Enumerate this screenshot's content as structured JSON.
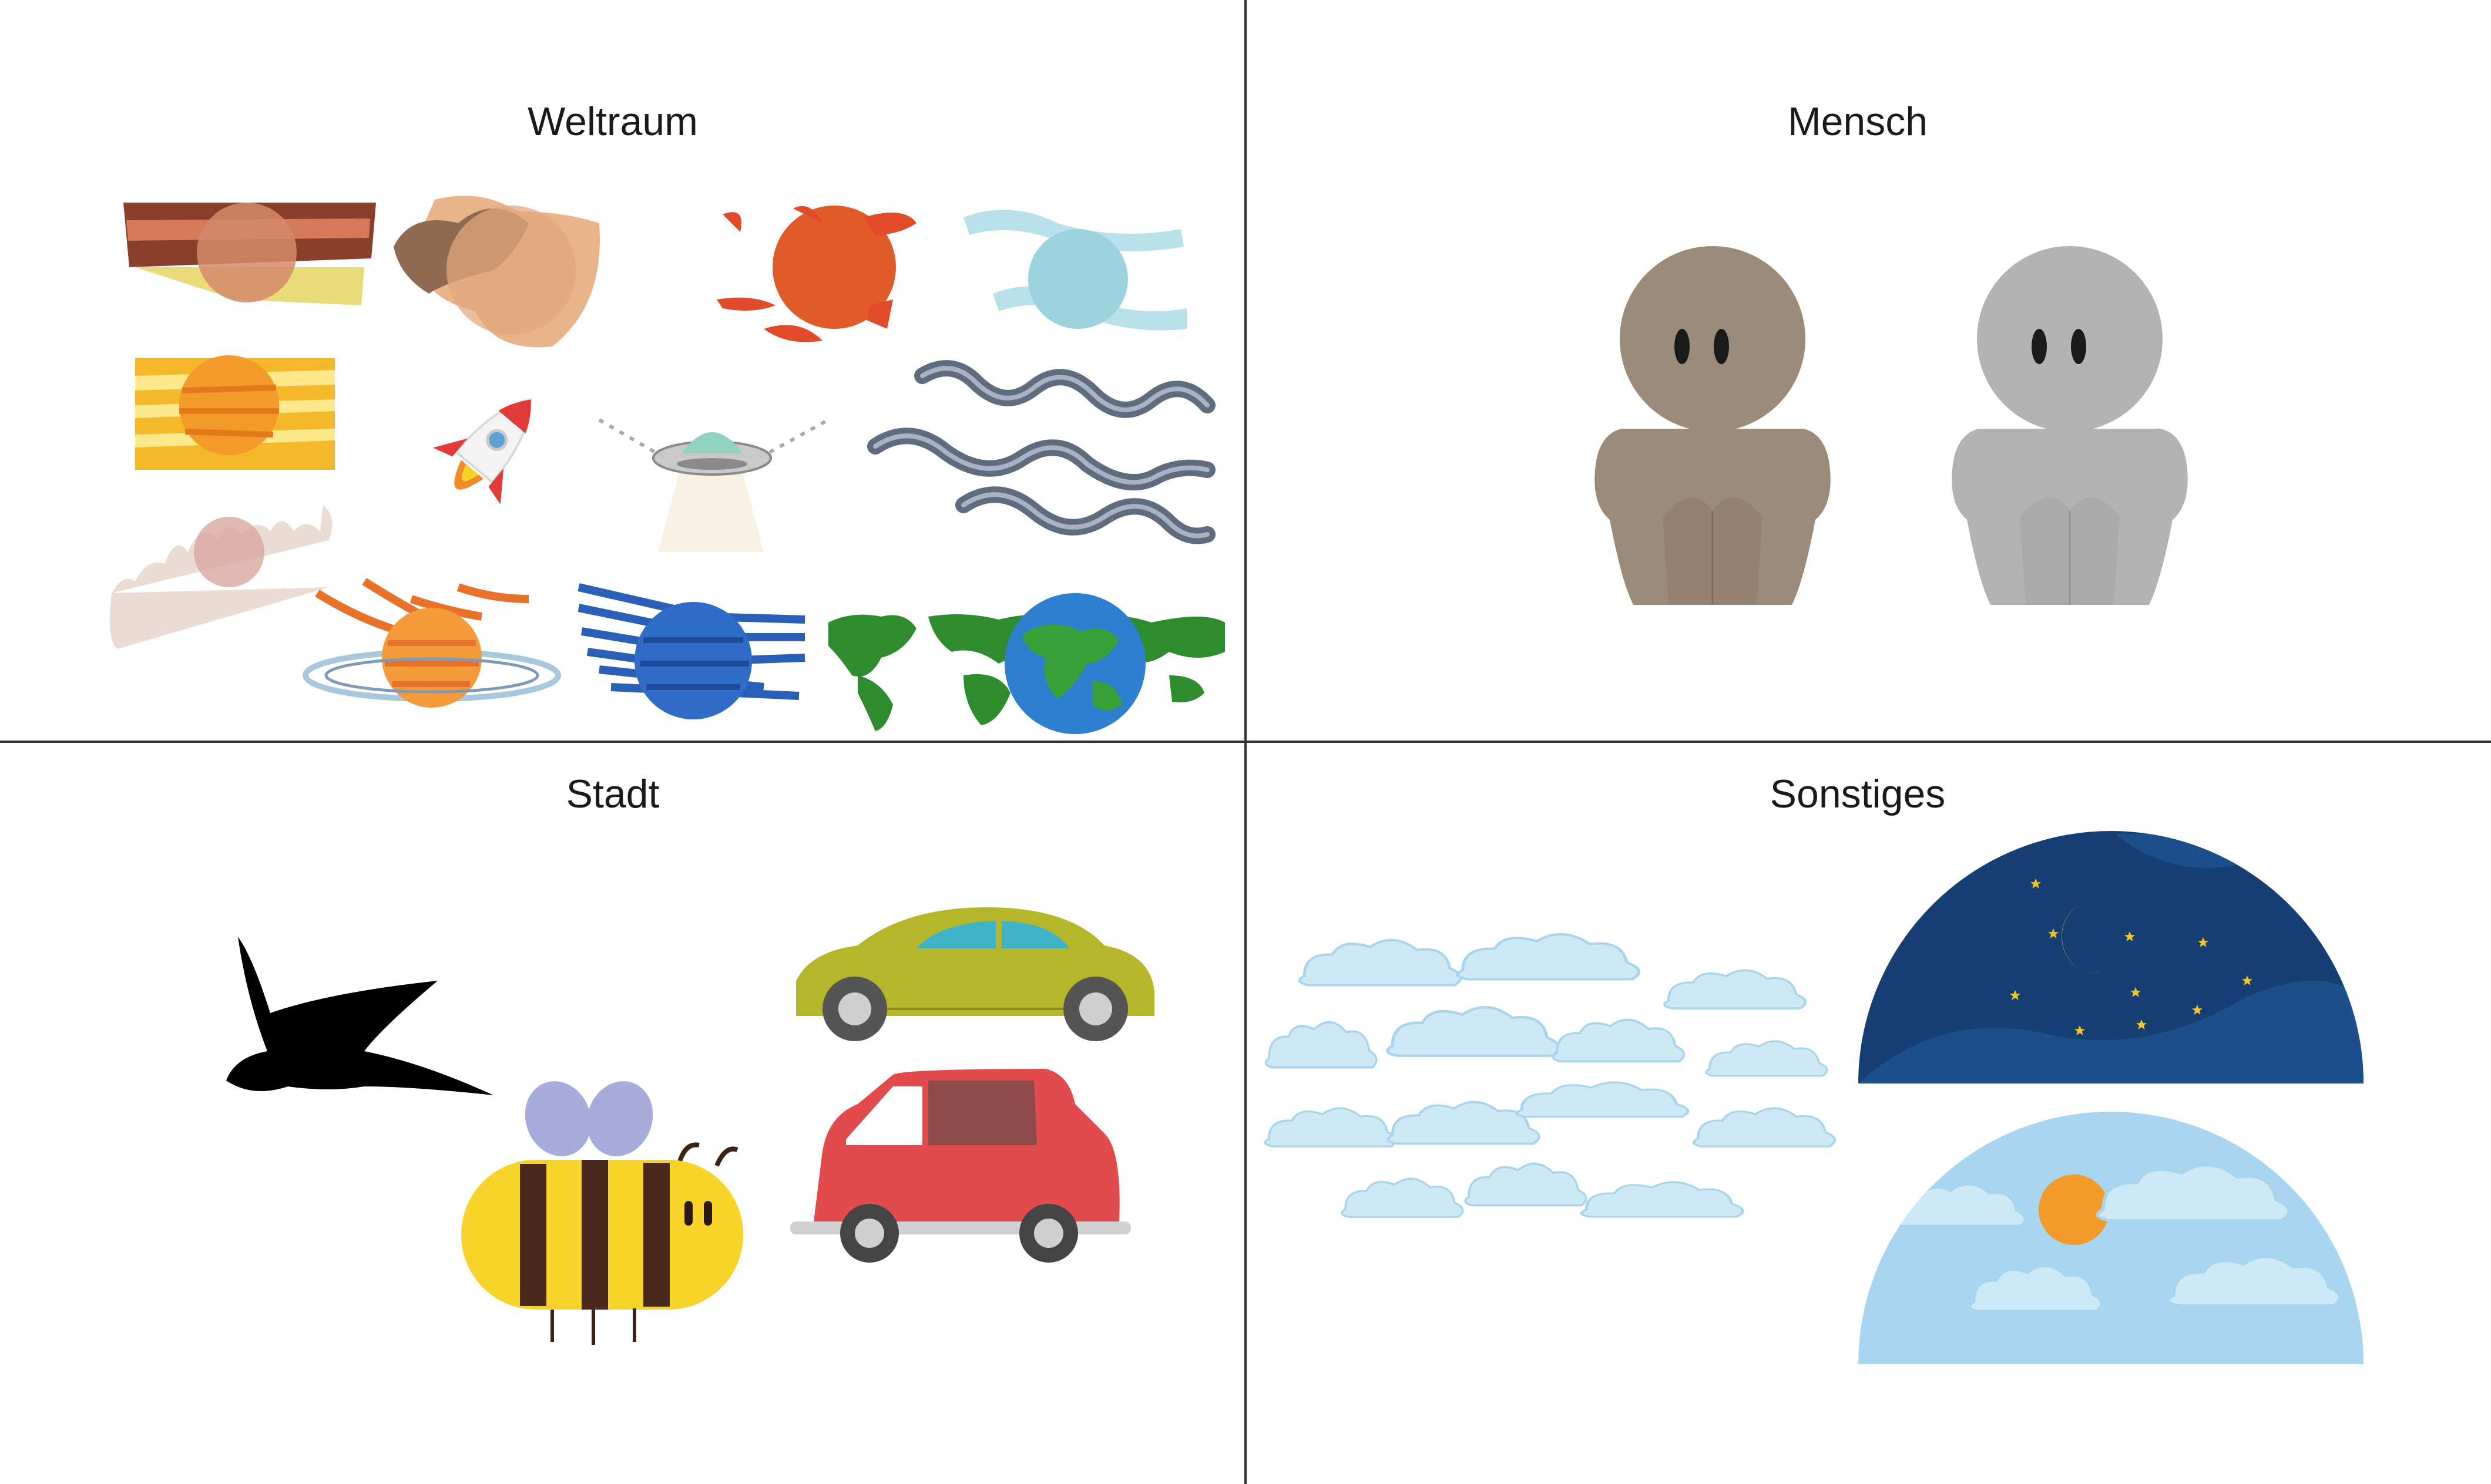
{
  "quadrants": {
    "weltraum": {
      "title": "Weltraum"
    },
    "mensch": {
      "title": "Mensch"
    },
    "stadt": {
      "title": "Stadt"
    },
    "sonstiges": {
      "title": "Sonstiges"
    }
  },
  "colors": {
    "divider": "#333333",
    "human_brown": "#9d8b7a",
    "human_gray": "#b3b3b3",
    "night_sky": "#173f73",
    "day_sky": "#a8d6f0",
    "sun": "#f29b2a",
    "moon": "#f5c521",
    "car_green": "#b6b62a",
    "car_red": "#e24b4b",
    "bee_yellow": "#f8d42a",
    "bee_stripe": "#4a2a1c",
    "cloud": "#cde9f6"
  },
  "icons": [
    "planet-icon",
    "rocket-icon",
    "ufo-icon",
    "earth-icon",
    "human-figure-icon",
    "bird-icon",
    "bee-icon",
    "car-icon",
    "cloud-icon",
    "moon-icon",
    "star-icon",
    "sun-icon"
  ]
}
